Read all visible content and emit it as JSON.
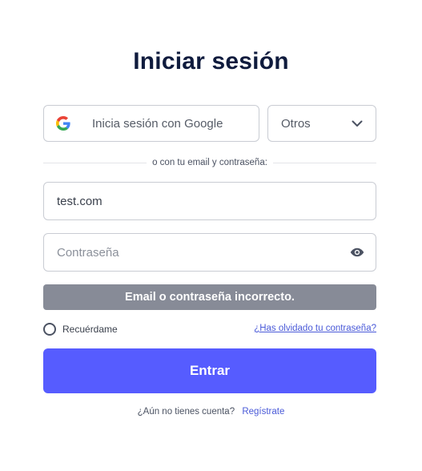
{
  "title": "Iniciar sesión",
  "social": {
    "google_label": "Inicia sesión con Google",
    "select_value": "Otros"
  },
  "divider_text": "o con tu email y contraseña:",
  "email": {
    "value": "test.com",
    "placeholder": ""
  },
  "password": {
    "value": "",
    "placeholder": "Contraseña"
  },
  "error_message": "Email o contraseña incorrecto.",
  "remember_label": "Recuérdame",
  "forgot_link": "¿Has olvidado tu contraseña?",
  "submit_label": "Entrar",
  "signup": {
    "question": "¿Aún no tienes cuenta?",
    "link": "Regístrate"
  },
  "colors": {
    "accent": "#565cff",
    "link": "#4a5ad8",
    "error_bg": "#878b97",
    "title": "#0f1b3d"
  }
}
